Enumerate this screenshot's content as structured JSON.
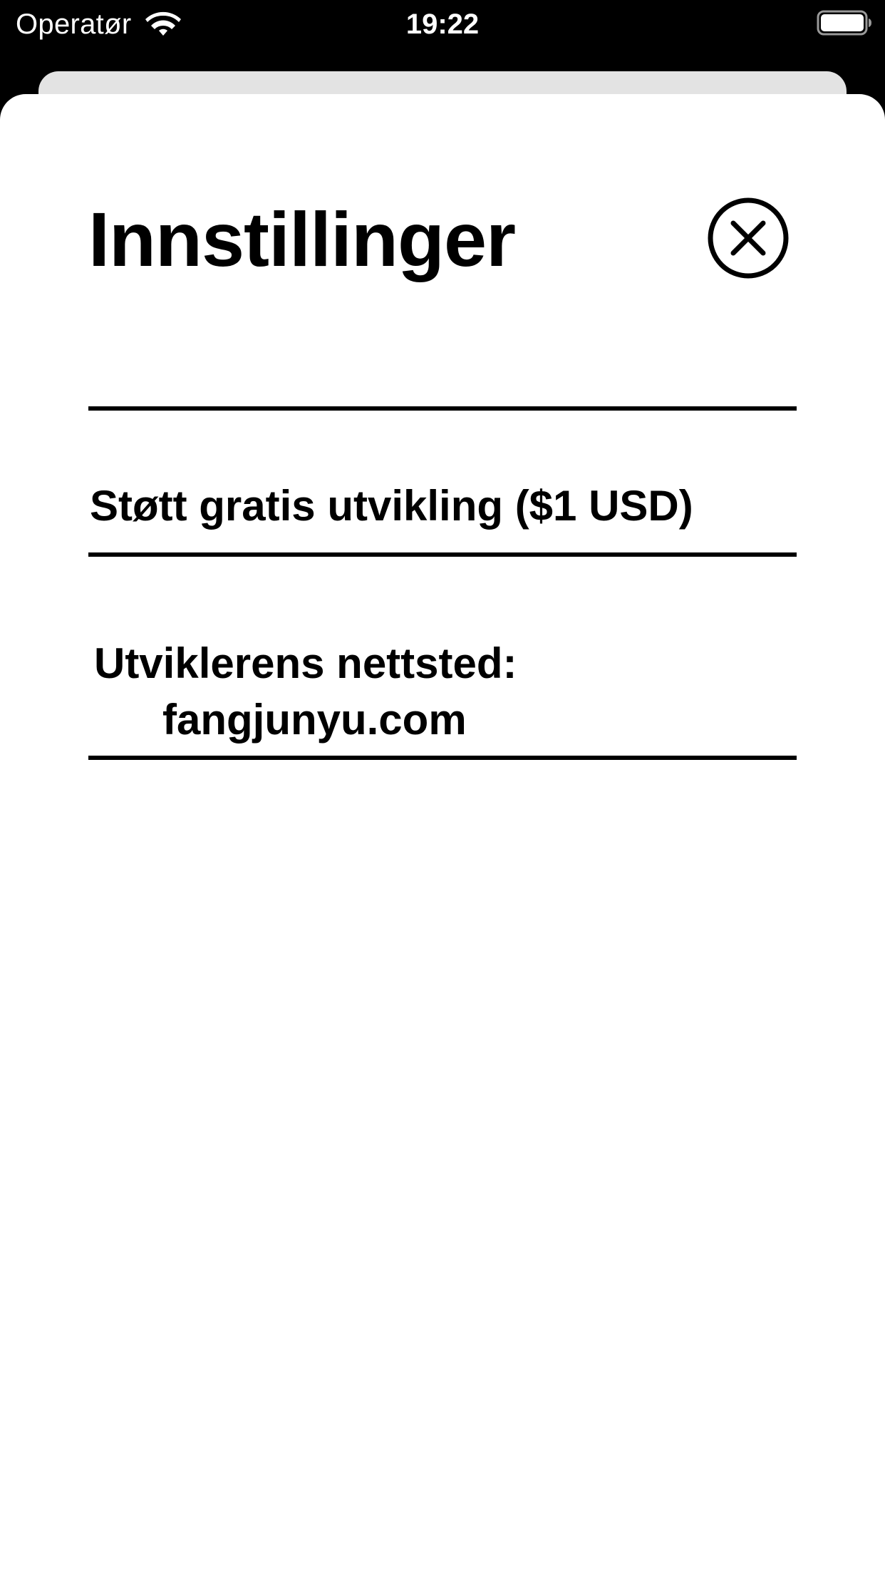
{
  "status_bar": {
    "carrier": "Operatør",
    "time": "19:22",
    "wifi_icon": "wifi-icon",
    "battery_icon": "battery-full-icon"
  },
  "sheet": {
    "title": "Innstillinger",
    "close_icon": "close-circle-icon",
    "rows": [
      {
        "label": "Støtt gratis utvikling ($1 USD)"
      },
      {
        "label_line1": "Utviklerens nettsted:",
        "label_line2": "fangjunyu.com"
      }
    ]
  },
  "colors": {
    "status_bar_bg": "#000000",
    "sheet_bg": "#ffffff",
    "behind_card": "#e3e3e3",
    "text": "#000000"
  }
}
